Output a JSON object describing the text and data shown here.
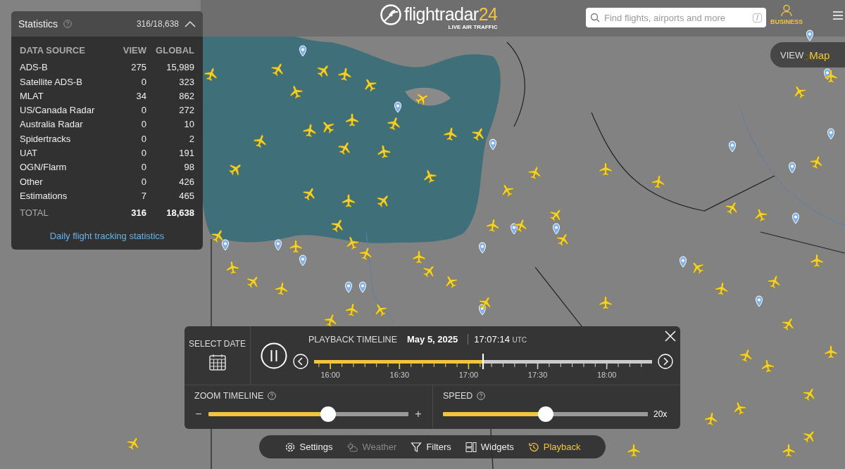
{
  "header": {
    "logo_text": "flightradar",
    "logo_number": "24",
    "tagline": "LIVE AIR TRAFFIC",
    "search": {
      "placeholder": "Find flights, airports and more",
      "shortcut": "/"
    },
    "account_label": "BUSINESS",
    "view": {
      "label": "VIEW",
      "value": "Map"
    }
  },
  "statistics": {
    "title": "Statistics",
    "count": "316/18,638",
    "expanded": true,
    "columns": [
      "DATA SOURCE",
      "VIEW",
      "GLOBAL"
    ],
    "rows": [
      {
        "source": "ADS-B",
        "view": "275",
        "global": "15,989"
      },
      {
        "source": "Satellite ADS-B",
        "view": "0",
        "global": "323"
      },
      {
        "source": "MLAT",
        "view": "34",
        "global": "862"
      },
      {
        "source": "US/Canada Radar",
        "view": "0",
        "global": "272"
      },
      {
        "source": "Australia Radar",
        "view": "0",
        "global": "10"
      },
      {
        "source": "Spidertracks",
        "view": "0",
        "global": "2"
      },
      {
        "source": "UAT",
        "view": "0",
        "global": "191"
      },
      {
        "source": "OGN/Flarm",
        "view": "0",
        "global": "98"
      },
      {
        "source": "Other",
        "view": "0",
        "global": "426"
      },
      {
        "source": "Estimations",
        "view": "7",
        "global": "465"
      }
    ],
    "total": {
      "label": "TOTAL",
      "view": "316",
      "global": "18,638"
    },
    "link": "Daily flight tracking statistics"
  },
  "playback": {
    "select_date_label": "SELECT DATE",
    "playing": true,
    "timeline_label": "PLAYBACK TIMELINE",
    "date": "May 5, 2025",
    "time": "17:07:14",
    "time_zone": "UTC",
    "level": 0.5,
    "ticks": [
      "16:00",
      "16:30",
      "17:00",
      "17:30",
      "18:00"
    ],
    "zoom_timeline": {
      "label": "ZOOM TIMELINE",
      "minus": "−",
      "plus": "+",
      "level": 0.6
    },
    "speed": {
      "label": "SPEED",
      "level": 0.5,
      "reading": "20x"
    }
  },
  "toolbar": [
    {
      "kind": "settings",
      "label": "Settings",
      "selected": false,
      "disabled": false
    },
    {
      "kind": "weather",
      "label": "Weather",
      "selected": false,
      "disabled": true
    },
    {
      "kind": "filters",
      "label": "Filters",
      "selected": false,
      "disabled": false
    },
    {
      "kind": "widgets",
      "label": "Widgets",
      "selected": false,
      "disabled": false
    },
    {
      "kind": "playback",
      "label": "Playback",
      "selected": true,
      "disabled": false
    }
  ]
}
